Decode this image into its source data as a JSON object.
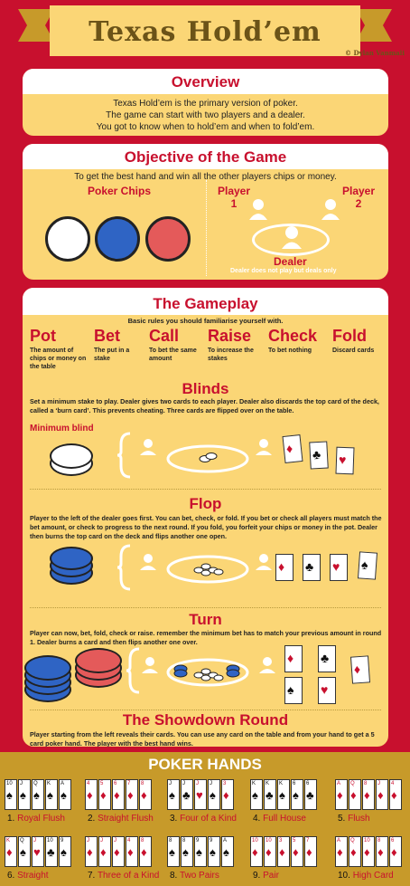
{
  "header": {
    "title": "Texas Hold’em",
    "credit": "© Dylan Vanmali"
  },
  "overview": {
    "heading": "Overview",
    "lines": [
      "Texas Hold’em is the primary version of poker.",
      "The game can start with two players and a dealer.",
      "You got to know when to hold’em and when to fold’em."
    ]
  },
  "objective": {
    "heading": "Objective of the Game",
    "intro": "To get the best hand and win all the other players chips or money.",
    "chips_label": "Poker Chips",
    "player1": "Player\n1",
    "player1_a": "Player",
    "player1_b": "1",
    "player2_a": "Player",
    "player2_b": "2",
    "dealer": "Dealer",
    "dealer_note": "Dealer does not play but deals only"
  },
  "gameplay": {
    "heading": "The Gameplay",
    "intro": "Basic rules you should familiarise yourself with.",
    "terms": [
      {
        "name": "Pot",
        "desc": "The amount of chips or money on the table"
      },
      {
        "name": "Bet",
        "desc": "The put in a stake"
      },
      {
        "name": "Call",
        "desc": "To bet the same amount"
      },
      {
        "name": "Raise",
        "desc": "To increase the stakes"
      },
      {
        "name": "Check",
        "desc": "To bet nothing"
      },
      {
        "name": "Fold",
        "desc": "Discard cards"
      }
    ],
    "blinds": {
      "title": "Blinds",
      "text": "Set a minimum stake to play. Dealer gives two cards to each player. Dealer also discards the top card of the deck, called a ‘burn card’. This prevents cheating. Three cards are flipped over on the table.",
      "min_label": "Minimum blind"
    },
    "flop": {
      "title": "Flop",
      "text": "Player to the left of the dealer goes first. You can bet, check, or fold. If you bet or check all players must match the bet amount, or check to progress to the next round. If you fold, you forfeit your chips or money in the pot. Dealer then burns the top card on the deck and flips another one open."
    },
    "turn": {
      "title": "Turn",
      "text": "Player can now, bet, fold, check or raise. remember the minimum bet has to match your previous amount in round 1. Dealer burns a card and then flips another one over."
    },
    "showdown": {
      "title": "The Showdown Round",
      "text": "Player starting from the left reveals their cards. You can use any card on the table and from your hand to get a 5 card poker hand. The player with the best hand wins."
    }
  },
  "hands": {
    "title": "POKER HANDS",
    "list": [
      {
        "num": "1.",
        "name": "Royal Flush",
        "cards": [
          [
            "10",
            "s"
          ],
          [
            "J",
            "s"
          ],
          [
            "Q",
            "s"
          ],
          [
            "K",
            "s"
          ],
          [
            "A",
            "s"
          ]
        ]
      },
      {
        "num": "2.",
        "name": "Straight Flush",
        "cards": [
          [
            "4",
            "d"
          ],
          [
            "5",
            "d"
          ],
          [
            "6",
            "d"
          ],
          [
            "7",
            "d"
          ],
          [
            "8",
            "d"
          ]
        ]
      },
      {
        "num": "3.",
        "name": "Four of a Kind",
        "cards": [
          [
            "J",
            "s"
          ],
          [
            "J",
            "c"
          ],
          [
            "J",
            "h"
          ],
          [
            "J",
            "s"
          ],
          [
            "3",
            "d"
          ]
        ]
      },
      {
        "num": "4.",
        "name": "Full House",
        "cards": [
          [
            "K",
            "s"
          ],
          [
            "K",
            "c"
          ],
          [
            "K",
            "s"
          ],
          [
            "6",
            "s"
          ],
          [
            "6",
            "c"
          ]
        ]
      },
      {
        "num": "5.",
        "name": "Flush",
        "cards": [
          [
            "A",
            "d"
          ],
          [
            "Q",
            "d"
          ],
          [
            "8",
            "d"
          ],
          [
            "J",
            "d"
          ],
          [
            "4",
            "d"
          ]
        ]
      },
      {
        "num": "6.",
        "name": "Straight",
        "cards": [
          [
            "K",
            "d"
          ],
          [
            "Q",
            "s"
          ],
          [
            "J",
            "h"
          ],
          [
            "10",
            "c"
          ],
          [
            "9",
            "s"
          ]
        ]
      },
      {
        "num": "7.",
        "name": "Three of a Kind",
        "cards": [
          [
            "J",
            "d"
          ],
          [
            "J",
            "d"
          ],
          [
            "J",
            "d"
          ],
          [
            "4",
            "d"
          ],
          [
            "8",
            "d"
          ]
        ]
      },
      {
        "num": "8.",
        "name": "Two Pairs",
        "cards": [
          [
            "8",
            "s"
          ],
          [
            "8",
            "s"
          ],
          [
            "9",
            "s"
          ],
          [
            "9",
            "s"
          ],
          [
            "A",
            "s"
          ]
        ]
      },
      {
        "num": "9.",
        "name": "Pair",
        "cards": [
          [
            "10",
            "d"
          ],
          [
            "10",
            "d"
          ],
          [
            "3",
            "d"
          ],
          [
            "5",
            "d"
          ],
          [
            "7",
            "d"
          ]
        ]
      },
      {
        "num": "10.",
        "name": "High Card",
        "cards": [
          [
            "A",
            "d"
          ],
          [
            "Q",
            "d"
          ],
          [
            "10",
            "d"
          ],
          [
            "8",
            "d"
          ],
          [
            "6",
            "d"
          ]
        ]
      }
    ]
  },
  "colors": {
    "background": "#c8102e",
    "panel": "#fbd676",
    "accent_red": "#c8102e",
    "gold": "#c79a2a",
    "title_brown": "#6b5318",
    "chip_blue": "#2f64c4",
    "chip_red": "#e45a5a"
  }
}
